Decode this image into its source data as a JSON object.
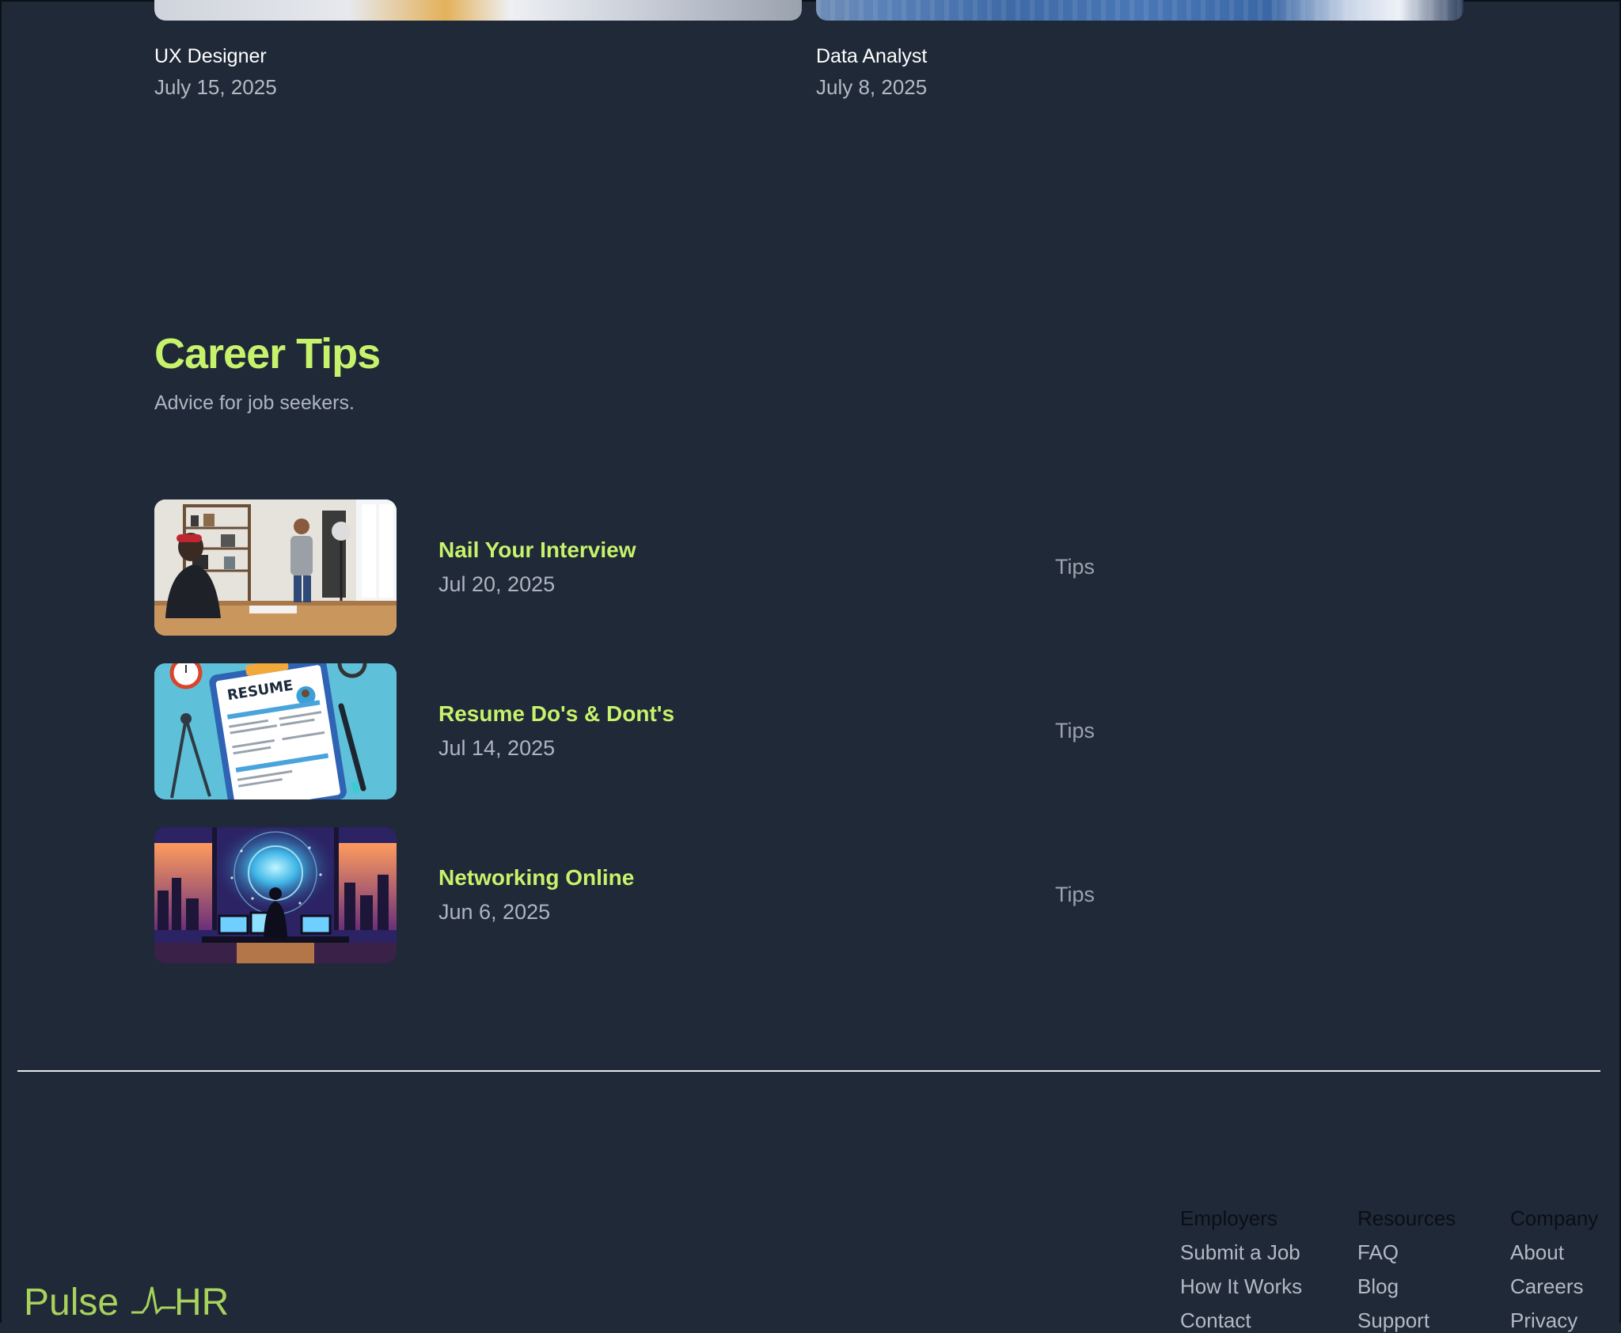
{
  "jobs": [
    {
      "title": "UX Designer",
      "date": "July 15, 2025"
    },
    {
      "title": "Data Analyst",
      "date": "July 8, 2025"
    }
  ],
  "career_tips": {
    "title": "Career Tips",
    "subtitle": "Advice for job seekers.",
    "items": [
      {
        "title": "Nail Your Interview",
        "date": "Jul 20, 2025",
        "tag": "Tips",
        "image": "interview-photo"
      },
      {
        "title": "Resume Do's & Dont's",
        "date": "Jul 14, 2025",
        "tag": "Tips",
        "image": "resume-illustration",
        "image_text": "RESUME"
      },
      {
        "title": "Networking Online",
        "date": "Jun 6, 2025",
        "tag": "Tips",
        "image": "networking-illustration"
      }
    ]
  },
  "footer": {
    "logo": {
      "left": "Pulse",
      "right": "HR"
    },
    "columns": [
      {
        "title": "Employers",
        "links": [
          "Submit a Job",
          "How It Works",
          "Contact"
        ]
      },
      {
        "title": "Resources",
        "links": [
          "FAQ",
          "Blog",
          "Support"
        ]
      },
      {
        "title": "Company",
        "links": [
          "About",
          "Careers",
          "Privacy"
        ]
      }
    ]
  },
  "colors": {
    "background": "#1f2937",
    "accent": "#c7f26b",
    "muted_text": "#aeb5c0",
    "logo": "#a8d25b"
  }
}
